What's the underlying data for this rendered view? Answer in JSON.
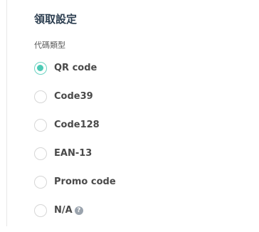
{
  "section": {
    "title": "領取設定"
  },
  "code_type": {
    "label": "代碼類型",
    "selected": "QR code",
    "options": [
      {
        "label": "QR code",
        "checked": true
      },
      {
        "label": "Code39",
        "checked": false
      },
      {
        "label": "Code128",
        "checked": false
      },
      {
        "label": "EAN-13",
        "checked": false
      },
      {
        "label": "Promo code",
        "checked": false
      },
      {
        "label": "N/A",
        "checked": false,
        "help_icon": "question-circle-icon"
      }
    ]
  },
  "colors": {
    "accent": "#4ccab5",
    "title": "#2c3e50",
    "label": "#4a4a4a"
  },
  "help_glyph": "?"
}
